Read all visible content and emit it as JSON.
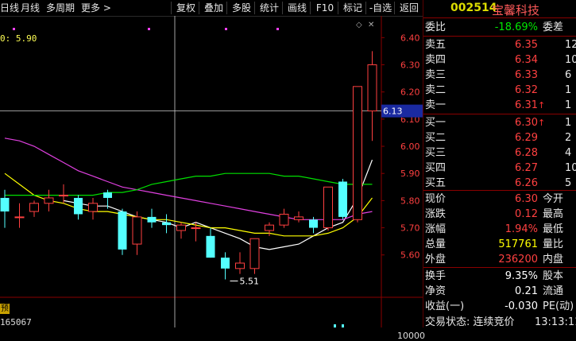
{
  "toolbar": {
    "left_items": [
      "日线",
      "月线",
      "多周期",
      "更多 >"
    ],
    "right_items": [
      "复权",
      "叠加",
      "多股",
      "统计",
      "画线",
      "F10",
      "标记",
      "-自选",
      "返回"
    ]
  },
  "chart_header": {
    "ma_label": "0: 5.90"
  },
  "axis": {
    "ticks": [
      "6.40",
      "6.30",
      "6.20",
      "6.10",
      "6.00",
      "5.90",
      "5.80",
      "5.70",
      "5.60"
    ],
    "current_price_tag": "6.13",
    "volume_tick": "10000"
  },
  "chart_annotations": {
    "low_label": "5.51",
    "vol_label": "165067",
    "indicator_box": "预"
  },
  "chart_data": {
    "type": "candlestick",
    "ylim": [
      5.45,
      6.48
    ],
    "candles": [
      {
        "o": 5.81,
        "h": 5.84,
        "l": 5.7,
        "c": 5.76
      },
      {
        "o": 5.74,
        "h": 5.79,
        "l": 5.7,
        "c": 5.74
      },
      {
        "o": 5.76,
        "h": 5.8,
        "l": 5.74,
        "c": 5.79
      },
      {
        "o": 5.79,
        "h": 5.84,
        "l": 5.76,
        "c": 5.81
      },
      {
        "o": 5.82,
        "h": 5.86,
        "l": 5.79,
        "c": 5.82
      },
      {
        "o": 5.81,
        "h": 5.82,
        "l": 5.73,
        "c": 5.75
      },
      {
        "o": 5.76,
        "h": 5.81,
        "l": 5.73,
        "c": 5.79
      },
      {
        "o": 5.83,
        "h": 5.84,
        "l": 5.77,
        "c": 5.81
      },
      {
        "o": 5.76,
        "h": 5.77,
        "l": 5.6,
        "c": 5.62
      },
      {
        "o": 5.64,
        "h": 5.76,
        "l": 5.6,
        "c": 5.74
      },
      {
        "o": 5.74,
        "h": 5.77,
        "l": 5.7,
        "c": 5.72
      },
      {
        "o": 5.72,
        "h": 5.75,
        "l": 5.68,
        "c": 5.71
      },
      {
        "o": 5.69,
        "h": 5.72,
        "l": 5.66,
        "c": 5.71
      },
      {
        "o": 5.7,
        "h": 5.72,
        "l": 5.65,
        "c": 5.7
      },
      {
        "o": 5.67,
        "h": 5.7,
        "l": 5.59,
        "c": 5.59
      },
      {
        "o": 5.59,
        "h": 5.61,
        "l": 5.51,
        "c": 5.55
      },
      {
        "o": 5.55,
        "h": 5.61,
        "l": 5.53,
        "c": 5.57
      },
      {
        "o": 5.55,
        "h": 5.66,
        "l": 5.53,
        "c": 5.66
      },
      {
        "o": 5.69,
        "h": 5.72,
        "l": 5.67,
        "c": 5.71
      },
      {
        "o": 5.71,
        "h": 5.77,
        "l": 5.7,
        "c": 5.75
      },
      {
        "o": 5.73,
        "h": 5.76,
        "l": 5.72,
        "c": 5.74
      },
      {
        "o": 5.73,
        "h": 5.74,
        "l": 5.68,
        "c": 5.7
      },
      {
        "o": 5.7,
        "h": 5.85,
        "l": 5.69,
        "c": 5.85
      },
      {
        "o": 5.87,
        "h": 5.88,
        "l": 5.73,
        "c": 5.74
      },
      {
        "o": 5.73,
        "h": 6.22,
        "l": 5.72,
        "c": 6.22
      },
      {
        "o": 6.13,
        "h": 6.35,
        "l": 6.02,
        "c": 6.3
      }
    ],
    "ma_lines": [
      {
        "color": "#ffffff",
        "values": [
          null,
          null,
          null,
          null,
          5.8,
          5.79,
          5.78,
          5.78,
          5.76,
          5.74,
          5.73,
          5.72,
          5.7,
          5.72,
          5.7,
          5.68,
          5.66,
          5.63,
          5.62,
          5.63,
          5.64,
          5.67,
          5.7,
          5.72,
          5.81,
          5.95
        ]
      },
      {
        "color": "#ffff00",
        "values": [
          5.9,
          5.86,
          5.82,
          5.8,
          5.79,
          5.77,
          5.76,
          5.76,
          5.75,
          5.74,
          5.73,
          5.73,
          5.72,
          5.71,
          5.7,
          5.7,
          5.69,
          5.68,
          5.68,
          5.67,
          5.67,
          5.67,
          5.68,
          5.7,
          5.74,
          5.81
        ]
      },
      {
        "color": "#e040e0",
        "values": [
          6.03,
          6.02,
          6.0,
          5.97,
          5.94,
          5.91,
          5.89,
          5.87,
          5.85,
          5.84,
          5.83,
          5.82,
          5.81,
          5.8,
          5.79,
          5.78,
          5.77,
          5.76,
          5.75,
          5.74,
          5.73,
          5.73,
          5.73,
          5.73,
          5.75,
          5.76
        ]
      },
      {
        "color": "#00e000",
        "values": [
          5.82,
          5.82,
          5.82,
          5.82,
          5.82,
          5.82,
          5.82,
          5.83,
          5.83,
          5.84,
          5.86,
          5.87,
          5.88,
          5.89,
          5.89,
          5.9,
          5.9,
          5.9,
          5.9,
          5.89,
          5.89,
          5.88,
          5.87,
          5.86,
          5.86,
          5.86
        ]
      }
    ]
  },
  "panel": {
    "code": "002514",
    "name": "宝馨科技",
    "weibi": {
      "label": "委比",
      "value": "-18.69%",
      "right": "委差"
    },
    "sells": [
      {
        "label": "卖五",
        "price": "6.35",
        "qty": "12"
      },
      {
        "label": "卖四",
        "price": "6.34",
        "qty": "10"
      },
      {
        "label": "卖三",
        "price": "6.33",
        "qty": "6"
      },
      {
        "label": "卖二",
        "price": "6.32",
        "qty": "1"
      },
      {
        "label": "卖一",
        "price": "6.31",
        "qty": "1"
      }
    ],
    "buys": [
      {
        "label": "买一",
        "price": "6.30",
        "qty": "1"
      },
      {
        "label": "买二",
        "price": "6.29",
        "qty": "2"
      },
      {
        "label": "买三",
        "price": "6.28",
        "qty": "4"
      },
      {
        "label": "买四",
        "price": "6.27",
        "qty": "10"
      },
      {
        "label": "买五",
        "price": "6.26",
        "qty": "5"
      }
    ],
    "stats1": [
      {
        "label": "现价",
        "value": "6.30",
        "right": "今开"
      },
      {
        "label": "涨跌",
        "value": "0.12",
        "right": "最高"
      },
      {
        "label": "涨幅",
        "value": "1.94%",
        "right": "最低"
      },
      {
        "label": "总量",
        "value": "517761",
        "right": "量比"
      },
      {
        "label": "外盘",
        "value": "236200",
        "right": "内盘"
      }
    ],
    "stats2": [
      {
        "label": "换手",
        "value": "9.35%",
        "right": "股本"
      },
      {
        "label": "净资",
        "value": "0.21",
        "right": "流通"
      },
      {
        "label": "收益(一)",
        "value": "-0.030",
        "right": "PE(动)"
      }
    ],
    "status": {
      "label": "交易状态: 连续竞价",
      "time": "13:13:11"
    }
  }
}
